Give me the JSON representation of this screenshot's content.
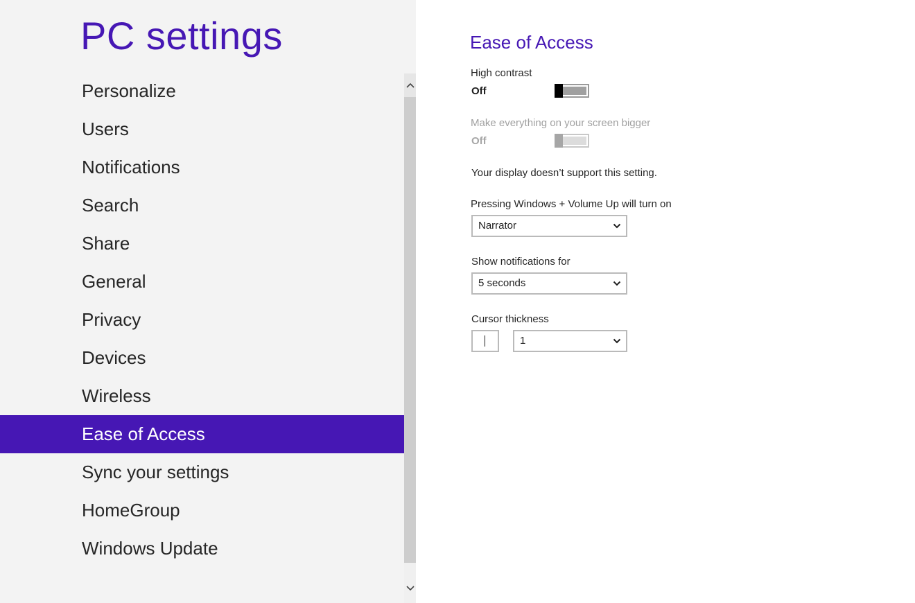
{
  "app": {
    "title": "PC settings"
  },
  "nav": {
    "items": [
      {
        "label": "Personalize"
      },
      {
        "label": "Users"
      },
      {
        "label": "Notifications"
      },
      {
        "label": "Search"
      },
      {
        "label": "Share"
      },
      {
        "label": "General"
      },
      {
        "label": "Privacy"
      },
      {
        "label": "Devices"
      },
      {
        "label": "Wireless"
      },
      {
        "label": "Ease of Access",
        "selected": true
      },
      {
        "label": "Sync your settings"
      },
      {
        "label": "HomeGroup"
      },
      {
        "label": "Windows Update"
      }
    ]
  },
  "content": {
    "title": "Ease of Access",
    "high_contrast": {
      "label": "High contrast",
      "state": "Off",
      "on": false
    },
    "make_bigger": {
      "label": "Make everything on your screen bigger",
      "state": "Off",
      "on": false,
      "enabled": false
    },
    "display_note": "Your display doesn’t support this setting.",
    "volume_shortcut": {
      "label": "Pressing Windows + Volume Up will turn on",
      "value": "Narrator"
    },
    "notifications": {
      "label": "Show notifications for",
      "value": "5 seconds"
    },
    "cursor_thickness": {
      "label": "Cursor thickness",
      "value": "1"
    }
  },
  "icons": {
    "scroll_up": "chevron-up-icon",
    "scroll_down": "chevron-down-icon",
    "dropdown": "chevron-down-icon"
  },
  "colors": {
    "accent": "#4617b4",
    "left_pane_bg": "#f3f3f3",
    "content_bg": "#ffffff"
  }
}
